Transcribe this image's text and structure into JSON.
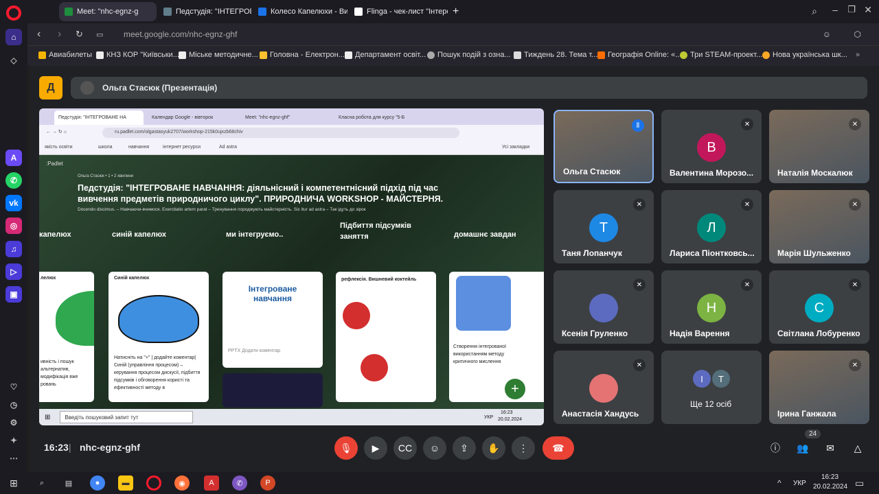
{
  "browser": {
    "tabs": [
      {
        "title": "Meet: \"nhc-egnz-g",
        "color": "#1e8e3e"
      },
      {
        "title": "Педстудія: \"ІНТЕГРОВАНЕ",
        "color": "#607d8b"
      },
      {
        "title": "Колесо Капелюхи - Випа",
        "color": "#1a73e8"
      },
      {
        "title": "Flinga - чек-лист \"Інтерo",
        "color": "#fff"
      }
    ],
    "new_tab": "+",
    "url": "meet.google.com/nhc-egnz-ghf",
    "bookmarks": [
      "Авиабилеты",
      "КНЗ КОР \"Київськи...",
      "Міське методичне...",
      "Головна - Електрон...",
      "Департамент освіт...",
      "Пошук подій з озна...",
      "Тиждень 28. Тема т...",
      "Географія Online: «...",
      "Три STEAM-проект...",
      "Нова українська шк..."
    ]
  },
  "presenter": {
    "logo": "Д",
    "label": "Ольга Стасюк (Презентація)"
  },
  "shared": {
    "tabs": [
      "Педстудія: \"ІНТЕГРОВАНЕ НА",
      "Календар Google - вівторок",
      "Meet: \"nhc-egnz-ghf\"",
      "Класна робота для курсу \"5-Б"
    ],
    "url": "ru.padlet.com/olgastasyuk2707/workshop-215k0ujxzb68chiv",
    "bookmarks": [
      "якість освіти",
      "школа",
      "навчання",
      "інтернет ресурси",
      "Ad astra",
      "Усі закладки"
    ],
    "padlet_brand": ":Padlet",
    "author": "Ольга Стасюк • 1 • 2 хвилини",
    "title": "Педстудія: \"ІНТЕГРОВАНЕ НАВЧАННЯ: діяльнісний і компетентнісний підхід під час вивчення предметів природничого циклу\". ПРИРОДНИЧА WORKSHOP - МАЙСТЕРНЯ.",
    "subtitle": "Docendo discimus. – Навчаючи-вчимося. Exercitatio artem parat – Тренування породжують майстерність. Sic itur ad astra – Так ідуть до зірок",
    "columns": [
      "капелюх",
      "синій капелюх",
      "ми інтегруємо..",
      "Підбиття підсумків заняття",
      "домашнє завдан"
    ],
    "cards": [
      {
        "title": "лелюх",
        "text": "ивність і пошук альтернатив, модифікація вже ровань"
      },
      {
        "title": "Синій капелюх",
        "text": "Натисніть на \"+\" | додайте коментар| Синій (управління процесом) – керування процесом дискусії, підбиття підсумків і обговорення користі та ефективності методу в"
      },
      {
        "title": "Інтегроване навчання",
        "text": "PPTX Додати коментар"
      },
      {
        "title": "рефлексія. Вишневий коктейль",
        "text": ""
      },
      {
        "title": "",
        "text": "Створення інтегрованої використанням методу критичного мислення"
      }
    ],
    "search_placeholder": "Введіть пошуковий запит тут",
    "clock": "16:23",
    "date": "20.02.2024",
    "lang": "УКР"
  },
  "participants": [
    {
      "name": "Ольга Стасюк",
      "initial": "",
      "color": "",
      "video": true,
      "speaking": true
    },
    {
      "name": "Валентина Морозо...",
      "initial": "В",
      "color": "#c2185b",
      "video": false
    },
    {
      "name": "Наталія Москалюк",
      "initial": "",
      "color": "",
      "video": true
    },
    {
      "name": "Таня Лопанчук",
      "initial": "Т",
      "color": "#1e88e5",
      "video": false
    },
    {
      "name": "Лариса Піонтковсь...",
      "initial": "Л",
      "color": "#00897b",
      "video": false
    },
    {
      "name": "Марія Шульженко",
      "initial": "",
      "color": "",
      "video": true
    },
    {
      "name": "Ксенія Груленко",
      "initial": "",
      "color": "#5c6bc0",
      "video": false
    },
    {
      "name": "Надія Варення",
      "initial": "Н",
      "color": "#7cb342",
      "video": false
    },
    {
      "name": "Світлана Лобуренко",
      "initial": "С",
      "color": "#00acc1",
      "video": false
    },
    {
      "name": "Анастасія Хандусь",
      "initial": "",
      "color": "#e57373",
      "video": false
    },
    {
      "name": "Ще 12 осіб",
      "initial": "",
      "color": "",
      "video": false,
      "more": [
        "І",
        "Т"
      ]
    },
    {
      "name": "Ірина Ганжала",
      "initial": "",
      "color": "",
      "video": true
    }
  ],
  "controls": {
    "time": "16:23",
    "meeting_code": "nhc-egnz-ghf",
    "people_count": "24"
  },
  "taskbar": {
    "lang": "УКР",
    "time": "16:23",
    "date": "20.02.2024"
  }
}
